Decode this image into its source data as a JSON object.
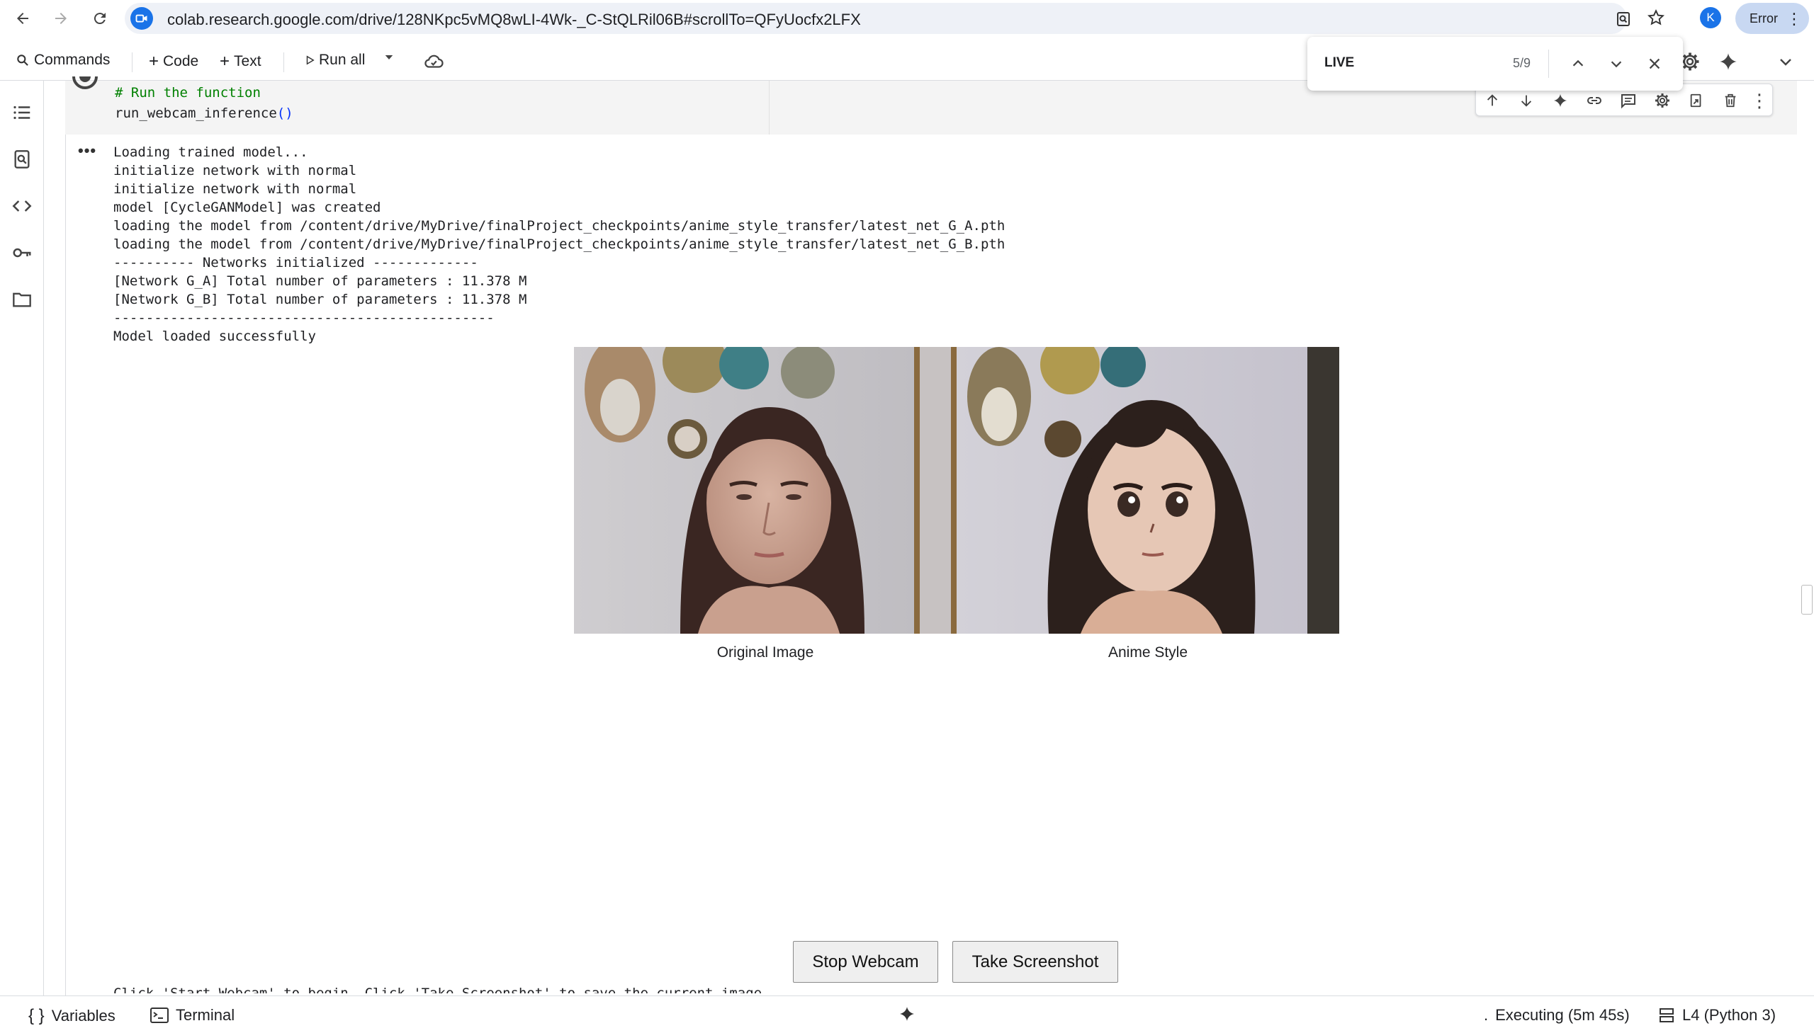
{
  "browser": {
    "url": "colab.research.google.com/drive/128NKpc5vMQ8wLI-4Wk-_C-StQLRil06B#scrollTo=QFyUocfx2LFX",
    "profile_initial": "K",
    "error_label": "Error"
  },
  "toolbar": {
    "commands": "Commands",
    "code": "Code",
    "text": "Text",
    "run_all": "Run all"
  },
  "find": {
    "query": "LIVE",
    "count": "5/9"
  },
  "cell": {
    "code_comment": "# Run the function",
    "code_call": "run_webcam_inference",
    "code_parens": "()"
  },
  "output": {
    "lines": [
      "Loading trained model...",
      "initialize network with normal",
      "initialize network with normal",
      "model [CycleGANModel] was created",
      "loading the model from /content/drive/MyDrive/finalProject_checkpoints/anime_style_transfer/latest_net_G_A.pth",
      "loading the model from /content/drive/MyDrive/finalProject_checkpoints/anime_style_transfer/latest_net_G_B.pth",
      "---------- Networks initialized -------------",
      "[Network G_A] Total number of parameters : 11.378 M",
      "[Network G_B] Total number of parameters : 11.378 M",
      "-----------------------------------------------",
      "Model loaded successfully"
    ],
    "caption_original": "Original Image",
    "caption_anime": "Anime Style",
    "stop_button": "Stop Webcam",
    "screenshot_button": "Take Screenshot",
    "instructions": "Click 'Start Webcam' to begin. Click 'Take Screenshot' to save the current image."
  },
  "statusbar": {
    "variables": "Variables",
    "terminal": "Terminal",
    "executing": "Executing (5m 45s)",
    "runtime": "L4 (Python 3)"
  },
  "colors": {
    "accent": "#1a73e8",
    "code_bg": "#f4f4f4",
    "comment": "#008000"
  }
}
